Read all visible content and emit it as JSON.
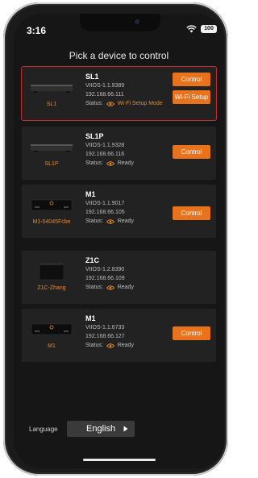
{
  "status_bar": {
    "time": "3:16",
    "battery": "100"
  },
  "title": "Pick a device to control",
  "devices": [
    {
      "name": "SL1",
      "label": "SL1",
      "firmware": "VIIOS-1.1.9389",
      "ip": "192.168.66.111",
      "status_label": "Status:",
      "status": "Wi-Fi Setup Mode",
      "buttons": [
        "Control",
        "Wi-Fi Setup"
      ]
    },
    {
      "name": "SL1P",
      "label": "SL1P",
      "firmware": "VIIOS-1.1.9328",
      "ip": "192.168.66.116",
      "status_label": "Status:",
      "status": "Ready",
      "buttons": [
        "Control"
      ]
    },
    {
      "name": "M1",
      "label": "M1-04045Fcbe",
      "firmware": "VIIOS-1.1.9017",
      "ip": "192.168.66.105",
      "status_label": "Status:",
      "status": "Ready",
      "buttons": [
        "Control"
      ]
    },
    {
      "name": "Z1C",
      "label": "Z1C-Zhang",
      "firmware": "VIIOS-1.2.8390",
      "ip": "192.168.66.109",
      "status_label": "Status:",
      "status": "Ready",
      "buttons": [
        "Control"
      ]
    },
    {
      "name": "M1",
      "label": "M1",
      "firmware": "VIIOS-1.1.6733",
      "ip": "192.168.66.127",
      "status_label": "Status:",
      "status": "Ready",
      "buttons": [
        "Control"
      ]
    }
  ],
  "language": {
    "label": "Language",
    "value": "English"
  },
  "colors": {
    "accent": "#e8731c",
    "selected_border": "#c72a2a",
    "background": "#161616",
    "card": "#222222"
  },
  "icons": {
    "wifi": "wifi-icon",
    "status": "eye-icon",
    "dropdown": "caret-right-icon"
  }
}
